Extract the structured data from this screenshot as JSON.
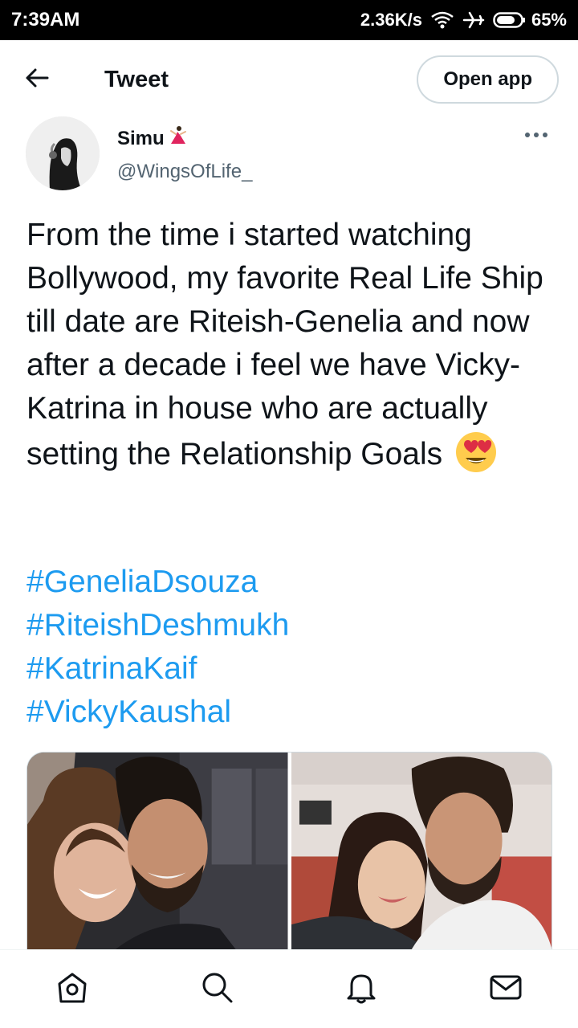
{
  "status_bar": {
    "time": "7:39AM",
    "speed": "2.36K/s",
    "battery": "65%",
    "icons": [
      "wifi-icon",
      "airplane-icon",
      "battery-icon"
    ]
  },
  "header": {
    "title": "Tweet",
    "open_app_label": "Open app"
  },
  "tweet": {
    "author": {
      "name": "Simu",
      "handle": "@WingsOfLife_"
    },
    "text": "From the time i started watching Bollywood, my favorite Real Life Ship till date are Riteish-Genelia and now after a decade i feel we have Vicky-Katrina in house who are actually setting the Relationship Goals",
    "hashtags": [
      "#GeneliaDsouza",
      "#RiteishDeshmukh",
      "#KatrinaKaif",
      "#VickyKaushal"
    ],
    "media_count": 2
  },
  "bottom_nav": [
    "home-icon",
    "search-icon",
    "notifications-icon",
    "messages-icon"
  ],
  "colors": {
    "accent": "#1d9bf0",
    "text": "#0f1419",
    "secondary": "#536471",
    "border": "#cfd9de"
  }
}
